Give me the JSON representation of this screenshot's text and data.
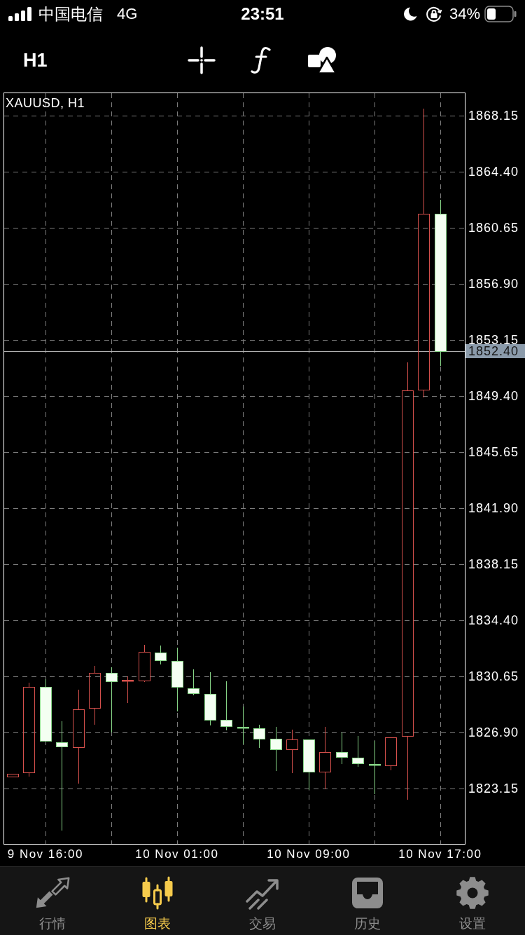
{
  "status_bar": {
    "carrier": "中国电信",
    "network": "4G",
    "time": "23:51",
    "battery": "34%"
  },
  "toolbar": {
    "timeframe": "H1"
  },
  "chart": {
    "chart_data": {
      "type": "candlestick",
      "title": "XAUUSD, H1",
      "categories": [
        null,
        null,
        "9 Nov 16:00",
        null,
        null,
        null,
        null,
        null,
        null,
        null,
        "10 Nov 01:00",
        null,
        null,
        null,
        null,
        null,
        null,
        null,
        "10 Nov 09:00",
        null,
        null,
        null,
        null,
        null,
        null,
        null,
        "10 Nov 17:00",
        null
      ],
      "ohlc": [
        [
          1823.95,
          1824.13,
          1823.95,
          1824.13
        ],
        [
          1824.23,
          1830.23,
          1823.95,
          1829.95
        ],
        [
          1829.95,
          1830.46,
          1826.34,
          1826.34
        ],
        [
          1826.24,
          1827.65,
          1820.34,
          1825.96
        ],
        [
          1825.92,
          1829.76,
          1823.48,
          1828.45
        ],
        [
          1828.54,
          1831.35,
          1827.42,
          1830.88
        ],
        [
          1830.88,
          1831.26,
          1826.9,
          1830.32
        ],
        [
          1830.32,
          1830.65,
          1828.87,
          1830.42
        ],
        [
          1830.37,
          1832.76,
          1830.28,
          1832.29
        ],
        [
          1832.24,
          1832.71,
          1831.45,
          1831.73
        ],
        [
          1831.68,
          1832.57,
          1828.31,
          1829.95
        ],
        [
          1829.85,
          1831.12,
          1829.38,
          1829.53
        ],
        [
          1829.48,
          1830.93,
          1827.37,
          1827.74
        ],
        [
          1827.74,
          1830.32,
          1827.04,
          1827.32
        ],
        [
          1827.28,
          1828.63,
          1826.1,
          1827.18
        ],
        [
          1827.18,
          1827.42,
          1825.87,
          1826.48
        ],
        [
          1826.48,
          1827.28,
          1824.32,
          1825.78
        ],
        [
          1825.78,
          1827.09,
          1824.18,
          1826.43
        ],
        [
          1826.43,
          1826.43,
          1823.06,
          1824.28
        ],
        [
          1824.28,
          1827.28,
          1823.1,
          1825.59
        ],
        [
          1825.59,
          1826.9,
          1824.79,
          1825.26
        ],
        [
          1825.21,
          1826.67,
          1824.6,
          1824.84
        ],
        [
          1824.79,
          1826.34,
          1822.78,
          1824.7
        ],
        [
          1824.7,
          1826.57,
          1824.37,
          1826.57
        ],
        [
          1826.67,
          1851.65,
          1822.4,
          1849.78
        ],
        [
          1849.82,
          1868.62,
          1849.31,
          1861.59
        ],
        [
          1861.59,
          1862.53,
          1851.42,
          1852.4
        ],
        null
      ],
      "ylim": [
        1819.45,
        1869.65
      ],
      "yticks": [
        {
          "value": 1868.15,
          "label": "1868.15"
        },
        {
          "value": 1864.4,
          "label": "1864.40"
        },
        {
          "value": 1860.65,
          "label": "1860.65"
        },
        {
          "value": 1856.9,
          "label": "1856.90"
        },
        {
          "value": 1853.15,
          "label": "1853.15"
        },
        {
          "value": 1849.4,
          "label": "1849.40"
        },
        {
          "value": 1845.65,
          "label": "1845.65"
        },
        {
          "value": 1841.9,
          "label": "1841.90"
        },
        {
          "value": 1838.15,
          "label": "1838.15"
        },
        {
          "value": 1834.4,
          "label": "1834.40"
        },
        {
          "value": 1830.65,
          "label": "1830.65"
        },
        {
          "value": 1826.9,
          "label": "1826.90"
        },
        {
          "value": 1823.15,
          "label": "1823.15"
        }
      ],
      "grid": true,
      "ref_lines": [
        {
          "axis": "y",
          "value": 1852.4,
          "label": "1852.40"
        }
      ]
    }
  },
  "tab_bar": {
    "tabs": [
      {
        "label": "行情",
        "selected": false
      },
      {
        "label": "图表",
        "selected": true
      },
      {
        "label": "交易",
        "selected": false
      },
      {
        "label": "历史",
        "selected": false
      },
      {
        "label": "设置",
        "selected": false
      }
    ]
  }
}
